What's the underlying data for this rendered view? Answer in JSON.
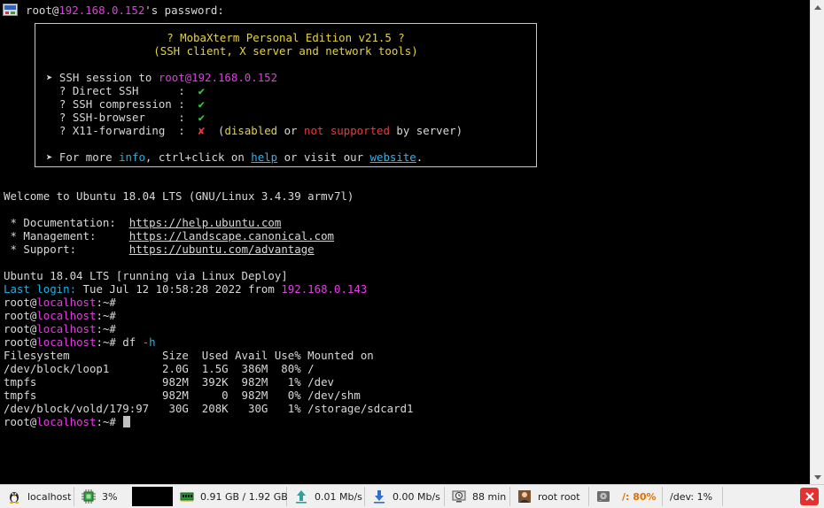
{
  "terminal": {
    "password_prompt": {
      "user": "root@",
      "host": "192.168.0.152",
      "suffix": "'s password:"
    },
    "banner": {
      "title": "? MobaXterm Personal Edition v21.5 ?",
      "subtitle": "(SSH client, X server and network tools)",
      "session_prefix": "➤ SSH session to ",
      "session_target": "root@192.168.0.152",
      "features": [
        {
          "label": "? Direct SSH      :",
          "status": "✔"
        },
        {
          "label": "? SSH compression :",
          "status": "✔"
        },
        {
          "label": "? SSH-browser     :",
          "status": "✔"
        }
      ],
      "x11_label": "? X11-forwarding  :",
      "x11_status": "✘",
      "x11_note_open": "  (",
      "x11_disabled": "disabled",
      "x11_or": " or ",
      "x11_not_supported": "not supported",
      "x11_by_server": " by server)",
      "more_prefix": "➤ For more ",
      "more_info": "info",
      "more_mid": ", ctrl+click on ",
      "more_help": "help",
      "more_visit": " or visit our ",
      "more_website": "website",
      "more_end": "."
    },
    "welcome": "Welcome to Ubuntu 18.04 LTS (GNU/Linux 3.4.39 armv7l)",
    "links": [
      {
        "label": " * Documentation:  ",
        "url": "https://help.ubuntu.com"
      },
      {
        "label": " * Management:     ",
        "url": "https://landscape.canonical.com"
      },
      {
        "label": " * Support:        ",
        "url": "https://ubuntu.com/advantage"
      }
    ],
    "deploy_line": "Ubuntu 18.04 LTS [running via Linux Deploy]",
    "last_login": {
      "label": "Last login:",
      "date": " Tue Jul 12 10:58:28 2022 from ",
      "ip": "192.168.0.143"
    },
    "prompt_user": "root@",
    "prompt_host": "localhost",
    "prompt_path": ":~#",
    "command": " df ",
    "command_flag": "-h",
    "df_header": "Filesystem              Size  Used Avail Use% Mounted on",
    "df_rows": [
      "/dev/block/loop1        2.0G  1.5G  386M  80% /",
      "tmpfs                   982M  392K  982M   1% /dev",
      "tmpfs                   982M     0  982M   0% /dev/shm",
      "/dev/block/vold/179:97   30G  208K   30G   1% /storage/sdcard1"
    ]
  },
  "statusbar": {
    "host": "localhost",
    "cpu": "3%",
    "memory": "0.91 GB / 1.92 GB",
    "upload": "0.01 Mb/s",
    "download": "0.00 Mb/s",
    "uptime": "88 min",
    "users": "root  root",
    "disk_root": "/: 80%",
    "disk_dev": "/dev: 1%"
  },
  "colors": {
    "prompt_host": "#e03ee0",
    "info_cyan": "#1fb1e6",
    "warn_yellow": "#e6d33c",
    "error_red": "#ee3a3a",
    "ok_green": "#36d236",
    "disk_alert": "#e07000"
  },
  "icons": {
    "terminal": "password-key-icon",
    "host": "tux-linux-icon",
    "cpu": "cpu-chip-icon",
    "memory": "memory-ram-icon",
    "upload": "upload-arrow-icon",
    "download": "download-arrow-icon",
    "uptime": "clock-monitor-icon",
    "users": "user-icon",
    "disk": "hard-disk-icon",
    "close": "close-icon"
  }
}
